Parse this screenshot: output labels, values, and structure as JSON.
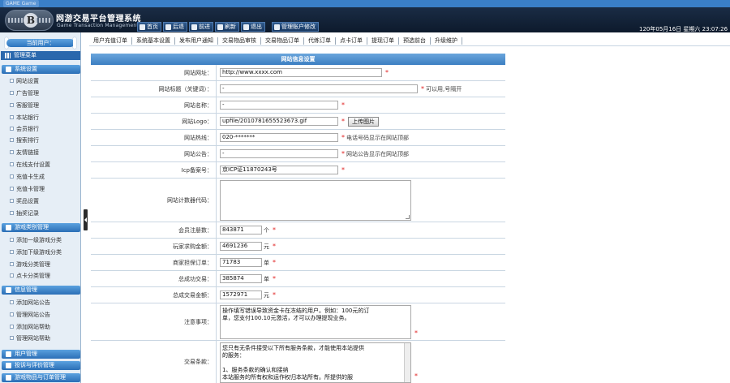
{
  "titlebar": {
    "tab": "GAME Game"
  },
  "header": {
    "logo_letter": "B",
    "title": "网游交易平台管理系统",
    "subtitle": "Game Transaction Management System",
    "nav": [
      {
        "label": "首页",
        "icon": "home-icon"
      },
      {
        "label": "后退",
        "icon": "back-arrow-icon"
      },
      {
        "label": "前进",
        "icon": "forward-arrow-icon"
      },
      {
        "label": "刷新",
        "icon": "refresh-icon"
      },
      {
        "label": "退出",
        "icon": "power-icon"
      },
      {
        "label": "管理账户修改",
        "icon": "account-icon"
      }
    ],
    "datetime": "120年05月16日 星期六 23:07:26"
  },
  "sidebar": {
    "current_user_label": "当前用户：",
    "menu_title": "管理菜单",
    "groups": [
      {
        "title": "系统设置",
        "items": [
          "网站设置",
          "广告管理",
          "客服管理",
          "本站银行",
          "会员银行",
          "搜索排行",
          "友情链接",
          "在线支付设置",
          "充值卡生成",
          "充值卡管理",
          "奖品设置",
          "抽奖记录"
        ]
      },
      {
        "title": "游戏类别管理",
        "items": [
          "添加一级游戏分类",
          "添加下级游戏分类",
          "游戏分类管理",
          "点卡分类管理"
        ]
      },
      {
        "title": "信息管理",
        "items": [
          "添加网站公告",
          "管理网站公告",
          "添加网站帮助",
          "管理网站帮助"
        ]
      },
      {
        "title": "用户管理",
        "items": []
      },
      {
        "title": "投诉与评价管理",
        "items": []
      },
      {
        "title": "游戏物品与订单管理",
        "items": []
      }
    ]
  },
  "tabs": [
    "用户充值订单",
    "系统基本设置",
    "发布用户通知",
    "交易物品审核",
    "交易物品订单",
    "代练订单",
    "点卡订单",
    "提现订单",
    "预选前台",
    "升级维护"
  ],
  "form": {
    "title": "网站信息设置",
    "site_url": {
      "label": "网站网址：",
      "value": "http://www.xxxx.com"
    },
    "site_keywords": {
      "label": "网站标题（关键词）：",
      "value": "-",
      "hint": "可以用,号隔开"
    },
    "site_name": {
      "label": "网站名称：",
      "value": "-"
    },
    "site_logo": {
      "label": "网站Logo：",
      "value": "upfile/2010781655523673.gif",
      "button": "上传图片"
    },
    "hotline": {
      "label": "网站热线：",
      "value": "020-*******",
      "hint": "电话号码显示在网站顶部"
    },
    "notice": {
      "label": "网站公告：",
      "value": "-",
      "hint": "网站公告显示在网站顶部"
    },
    "icp": {
      "label": "Icp备案号：",
      "value": "京ICP证11870243号"
    },
    "counter_code": {
      "label": "网站计数器代码：",
      "value": ""
    },
    "member_count": {
      "label": "会员注册数：",
      "value": "843871",
      "unit": "个"
    },
    "player_buy": {
      "label": "玩家求购金额：",
      "value": "4691236",
      "unit": "元"
    },
    "merchant_orders": {
      "label": "商家担保订单：",
      "value": "71783",
      "unit": "单"
    },
    "total_trades": {
      "label": "总成功交易：",
      "value": "385874",
      "unit": "单"
    },
    "total_amount": {
      "label": "总成交易金额：",
      "value": "1572971",
      "unit": "元"
    },
    "notice_text": {
      "label": "注意事项：",
      "lines": [
        "操作填写错误导致资金卡在冻结的用户。例如：100元的订",
        "单，您支付100.10元激活，才可以办理提现业务。"
      ]
    },
    "terms": {
      "label": "交易条款：",
      "lines": [
        "您只有无条件接受以下所有服务条款，才能使用本站提供",
        "的服务：",
        "",
        "1、服务条款的确认和接纳",
        "   本站服务的所有权和运作权归本站所有。所提供的服"
      ]
    }
  }
}
